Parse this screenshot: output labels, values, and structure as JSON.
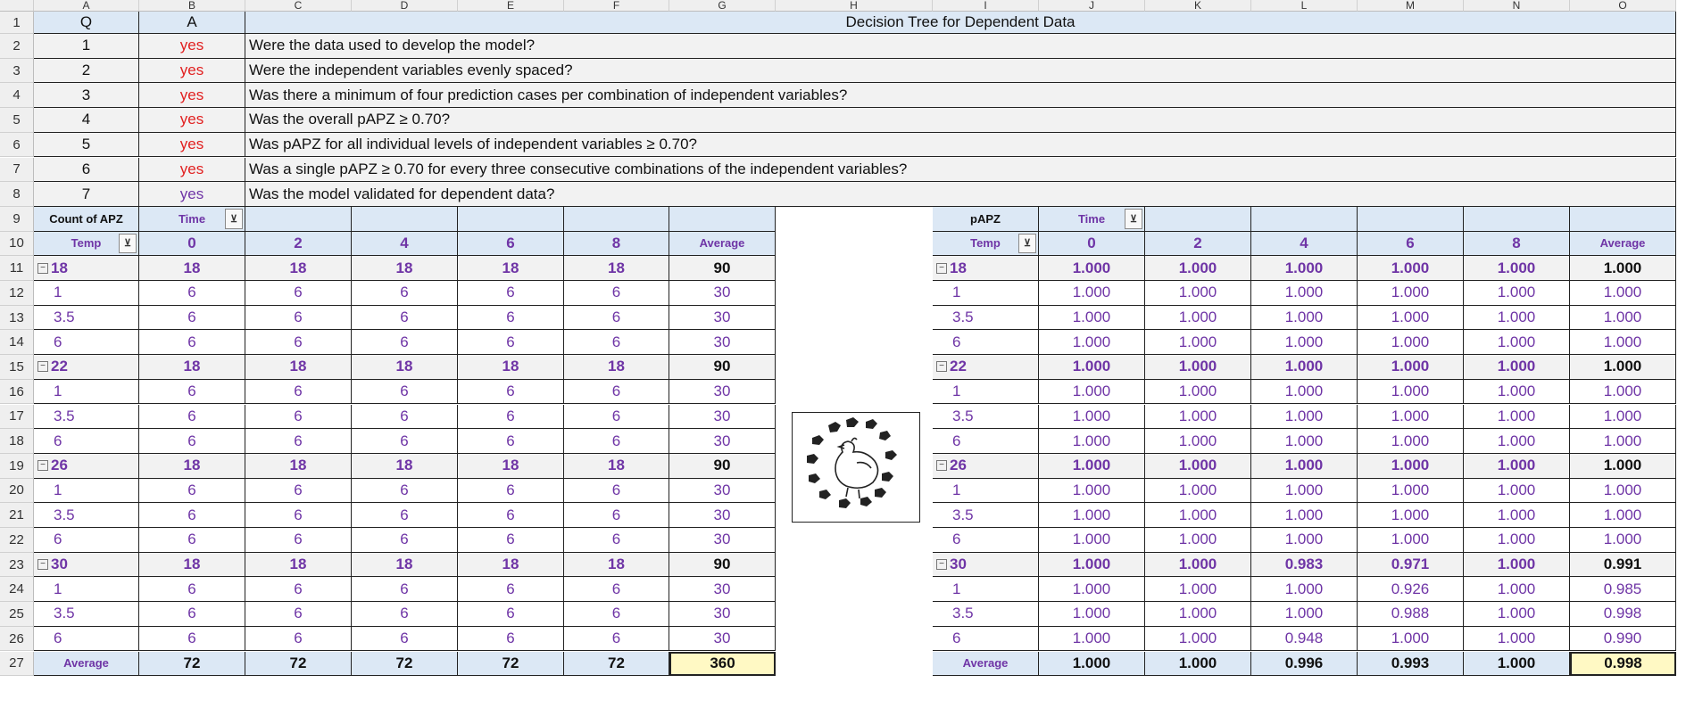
{
  "columns": [
    "A",
    "B",
    "C",
    "D",
    "E",
    "F",
    "G",
    "H",
    "I",
    "J",
    "K",
    "L",
    "M",
    "N",
    "O"
  ],
  "rows": [
    "1",
    "2",
    "3",
    "4",
    "5",
    "6",
    "7",
    "8",
    "9",
    "10",
    "11",
    "12",
    "13",
    "14",
    "15",
    "16",
    "17",
    "18",
    "19",
    "20",
    "21",
    "22",
    "23",
    "24",
    "25",
    "26",
    "27"
  ],
  "qa": {
    "header_q": "Q",
    "header_a": "A",
    "title": "Decision Tree for Dependent Data",
    "items": [
      {
        "q": "1",
        "a": "yes",
        "text": "Were the data used to develop the model?"
      },
      {
        "q": "2",
        "a": "yes",
        "text": "Were the independent variables evenly spaced?"
      },
      {
        "q": "3",
        "a": "yes",
        "text": "Was there a minimum of four prediction cases per combination of independent variables?"
      },
      {
        "q": "4",
        "a": "yes",
        "text": "Was the overall pAPZ ≥ 0.70?"
      },
      {
        "q": "5",
        "a": "yes",
        "text": "Was pAPZ for all individual levels of independent variables ≥ 0.70?"
      },
      {
        "q": "6",
        "a": "yes",
        "text": "Was a single pAPZ ≥ 0.70 for every three consecutive combinations of the independent variables?"
      },
      {
        "q": "7",
        "a": "yes",
        "text": "Was the model validated for dependent data?"
      }
    ]
  },
  "pivot_count": {
    "label": "Count of APZ",
    "col_field": "Time",
    "row_field": "Temp",
    "time_values": [
      "0",
      "2",
      "4",
      "6",
      "8"
    ],
    "average_label": "Average",
    "groups": [
      {
        "temp": "18",
        "values": [
          "18",
          "18",
          "18",
          "18",
          "18",
          "90"
        ],
        "rows": [
          {
            "label": "1",
            "values": [
              "6",
              "6",
              "6",
              "6",
              "6",
              "30"
            ]
          },
          {
            "label": "3.5",
            "values": [
              "6",
              "6",
              "6",
              "6",
              "6",
              "30"
            ]
          },
          {
            "label": "6",
            "values": [
              "6",
              "6",
              "6",
              "6",
              "6",
              "30"
            ]
          }
        ]
      },
      {
        "temp": "22",
        "values": [
          "18",
          "18",
          "18",
          "18",
          "18",
          "90"
        ],
        "rows": [
          {
            "label": "1",
            "values": [
              "6",
              "6",
              "6",
              "6",
              "6",
              "30"
            ]
          },
          {
            "label": "3.5",
            "values": [
              "6",
              "6",
              "6",
              "6",
              "6",
              "30"
            ]
          },
          {
            "label": "6",
            "values": [
              "6",
              "6",
              "6",
              "6",
              "6",
              "30"
            ]
          }
        ]
      },
      {
        "temp": "26",
        "values": [
          "18",
          "18",
          "18",
          "18",
          "18",
          "90"
        ],
        "rows": [
          {
            "label": "1",
            "values": [
              "6",
              "6",
              "6",
              "6",
              "6",
              "30"
            ]
          },
          {
            "label": "3.5",
            "values": [
              "6",
              "6",
              "6",
              "6",
              "6",
              "30"
            ]
          },
          {
            "label": "6",
            "values": [
              "6",
              "6",
              "6",
              "6",
              "6",
              "30"
            ]
          }
        ]
      },
      {
        "temp": "30",
        "values": [
          "18",
          "18",
          "18",
          "18",
          "18",
          "90"
        ],
        "rows": [
          {
            "label": "1",
            "values": [
              "6",
              "6",
              "6",
              "6",
              "6",
              "30"
            ]
          },
          {
            "label": "3.5",
            "values": [
              "6",
              "6",
              "6",
              "6",
              "6",
              "30"
            ]
          },
          {
            "label": "6",
            "values": [
              "6",
              "6",
              "6",
              "6",
              "6",
              "30"
            ]
          }
        ]
      }
    ],
    "total": {
      "label": "Average",
      "values": [
        "72",
        "72",
        "72",
        "72",
        "72",
        "360"
      ]
    }
  },
  "pivot_papz": {
    "label": "pAPZ",
    "col_field": "Time",
    "row_field": "Temp",
    "time_values": [
      "0",
      "2",
      "4",
      "6",
      "8"
    ],
    "average_label": "Average",
    "groups": [
      {
        "temp": "18",
        "values": [
          "1.000",
          "1.000",
          "1.000",
          "1.000",
          "1.000",
          "1.000"
        ],
        "rows": [
          {
            "label": "1",
            "values": [
              "1.000",
              "1.000",
              "1.000",
              "1.000",
              "1.000",
              "1.000"
            ]
          },
          {
            "label": "3.5",
            "values": [
              "1.000",
              "1.000",
              "1.000",
              "1.000",
              "1.000",
              "1.000"
            ]
          },
          {
            "label": "6",
            "values": [
              "1.000",
              "1.000",
              "1.000",
              "1.000",
              "1.000",
              "1.000"
            ]
          }
        ]
      },
      {
        "temp": "22",
        "values": [
          "1.000",
          "1.000",
          "1.000",
          "1.000",
          "1.000",
          "1.000"
        ],
        "rows": [
          {
            "label": "1",
            "values": [
              "1.000",
              "1.000",
              "1.000",
              "1.000",
              "1.000",
              "1.000"
            ]
          },
          {
            "label": "3.5",
            "values": [
              "1.000",
              "1.000",
              "1.000",
              "1.000",
              "1.000",
              "1.000"
            ]
          },
          {
            "label": "6",
            "values": [
              "1.000",
              "1.000",
              "1.000",
              "1.000",
              "1.000",
              "1.000"
            ]
          }
        ]
      },
      {
        "temp": "26",
        "values": [
          "1.000",
          "1.000",
          "1.000",
          "1.000",
          "1.000",
          "1.000"
        ],
        "rows": [
          {
            "label": "1",
            "values": [
              "1.000",
              "1.000",
              "1.000",
              "1.000",
              "1.000",
              "1.000"
            ]
          },
          {
            "label": "3.5",
            "values": [
              "1.000",
              "1.000",
              "1.000",
              "1.000",
              "1.000",
              "1.000"
            ]
          },
          {
            "label": "6",
            "values": [
              "1.000",
              "1.000",
              "1.000",
              "1.000",
              "1.000",
              "1.000"
            ]
          }
        ]
      },
      {
        "temp": "30",
        "values": [
          "1.000",
          "1.000",
          "0.983",
          "0.971",
          "1.000",
          "0.991"
        ],
        "rows": [
          {
            "label": "1",
            "values": [
              "1.000",
              "1.000",
              "1.000",
              "0.926",
              "1.000",
              "0.985"
            ]
          },
          {
            "label": "3.5",
            "values": [
              "1.000",
              "1.000",
              "1.000",
              "0.988",
              "1.000",
              "0.998"
            ]
          },
          {
            "label": "6",
            "values": [
              "1.000",
              "1.000",
              "0.948",
              "1.000",
              "1.000",
              "0.990"
            ]
          }
        ]
      }
    ],
    "total": {
      "label": "Average",
      "values": [
        "1.000",
        "1.000",
        "0.996",
        "0.993",
        "1.000",
        "0.998"
      ]
    }
  },
  "picture": {
    "icon": "hen-with-chicks-icon"
  },
  "colors": {
    "answer_red": "#e11f1f",
    "answer_purple": "#6f35a6",
    "pivot_text": "#6f35a6",
    "header_blue": "#dce8f5",
    "row_gray": "#f2f2f2",
    "grand_total": "#fff9c4"
  }
}
